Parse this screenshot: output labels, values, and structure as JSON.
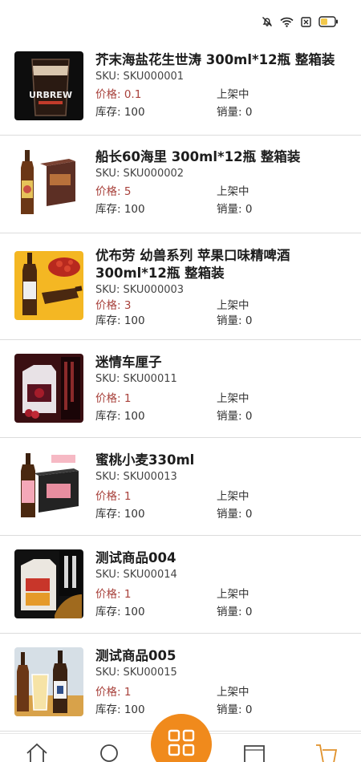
{
  "status_bar": {
    "icons": [
      "mute-bell-icon",
      "wifi-icon",
      "no-sim-icon",
      "battery-icon"
    ]
  },
  "products": [
    {
      "name": "芥末海盐花生世涛 300ml*12瓶 整箱装",
      "sku": "SKU: SKU000001",
      "price": "价格: 0.1",
      "status": "上架中",
      "stock": "库存: 100",
      "sales": "销量: 0",
      "image_text": "URBREW"
    },
    {
      "name": "船长60海里 300ml*12瓶 整箱装",
      "sku": "SKU: SKU000002",
      "price": "价格: 5",
      "status": "上架中",
      "stock": "库存: 100",
      "sales": "销量: 0"
    },
    {
      "name": "优布劳 幼兽系列 苹果口味精啤酒 300ml*12瓶 整箱装",
      "sku": "SKU: SKU000003",
      "price": "价格: 3",
      "status": "上架中",
      "stock": "库存: 100",
      "sales": "销量: 0"
    },
    {
      "name": "迷情车厘子",
      "sku": "SKU: SKU00011",
      "price": "价格: 1",
      "status": "上架中",
      "stock": "库存: 100",
      "sales": "销量: 0"
    },
    {
      "name": "蜜桃小麦330ml",
      "sku": "SKU: SKU00013",
      "price": "价格: 1",
      "status": "上架中",
      "stock": "库存: 100",
      "sales": "销量: 0"
    },
    {
      "name": "测试商品004",
      "sku": "SKU: SKU00014",
      "price": "价格: 1",
      "status": "上架中",
      "stock": "库存: 100",
      "sales": "销量: 0"
    },
    {
      "name": "测试商品005",
      "sku": "SKU: SKU00015",
      "price": "价格: 1",
      "status": "上架中",
      "stock": "库存: 100",
      "sales": "销量: 0"
    }
  ],
  "bottom_nav": {
    "icons": [
      "home-icon",
      "search-icon",
      "apps-grid-icon",
      "message-icon",
      "cart-icon"
    ]
  },
  "colors": {
    "accent": "#f08a1c",
    "price": "#a8413b",
    "divider": "#dcdcdc"
  }
}
